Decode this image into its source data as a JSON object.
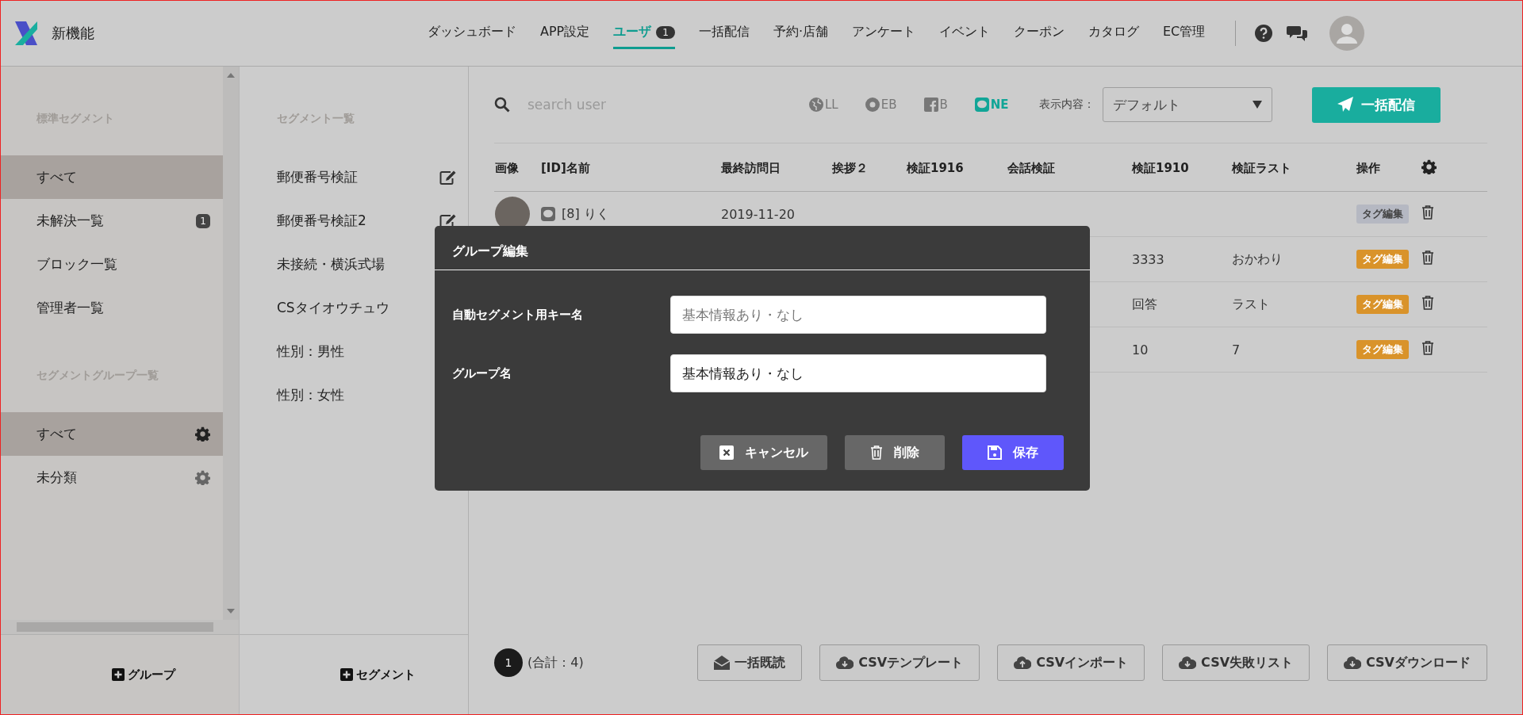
{
  "header": {
    "app_name": "新機能",
    "nav": [
      {
        "label": "ダッシュボード",
        "selected": false
      },
      {
        "label": "APP設定",
        "selected": false
      },
      {
        "label": "ユーザ",
        "selected": true,
        "badge": "1"
      },
      {
        "label": "一括配信",
        "selected": false
      },
      {
        "label": "予約·店舗",
        "selected": false
      },
      {
        "label": "アンケート",
        "selected": false
      },
      {
        "label": "イベント",
        "selected": false
      },
      {
        "label": "クーポン",
        "selected": false
      },
      {
        "label": "カタログ",
        "selected": false
      },
      {
        "label": "EC管理",
        "selected": false
      }
    ]
  },
  "sidebar": {
    "sections": [
      {
        "heading": "標準セグメント",
        "items": [
          {
            "label": "すべて",
            "selected": true
          },
          {
            "label": "未解決一覧",
            "selected": false,
            "badge": "1"
          },
          {
            "label": "ブロック一覧",
            "selected": false
          },
          {
            "label": "管理者一覧",
            "selected": false
          }
        ]
      },
      {
        "heading": "セグメントグループ一覧",
        "items": [
          {
            "label": "すべて",
            "selected": true,
            "settings": true
          },
          {
            "label": "未分類",
            "selected": false,
            "settings": true
          }
        ]
      }
    ],
    "add_button": "グループ"
  },
  "segments": {
    "heading": "セグメント一覧",
    "items": [
      "郵便番号検証",
      "郵便番号検証2",
      "未接続・横浜式場",
      "CSタイオウチュウ",
      "性別：男性",
      "性別：女性"
    ],
    "add_button": "セグメント"
  },
  "toolbar": {
    "search": {
      "placeholder": "search user"
    },
    "filters": [
      {
        "kind": "all",
        "label": "LL",
        "selected": false
      },
      {
        "kind": "web",
        "label": "EB",
        "selected": false
      },
      {
        "kind": "fb",
        "label": "B",
        "selected": false
      },
      {
        "kind": "line",
        "label": "NE",
        "selected": true
      }
    ],
    "display_label": "表示内容：",
    "display_value": "デフォルト",
    "send_button": "一括配信"
  },
  "table": {
    "columns": [
      "画像",
      "[ID]名前",
      "最終訪問日",
      "挨拶２",
      "検証1916",
      "会話検証",
      "検証1910",
      "検証ラスト",
      "操作"
    ],
    "rows": [
      {
        "cells": [
          "",
          "[8] りく",
          "2019-11-20"
        ],
        "tag_button": "タグ編集",
        "tag_disabled": true
      },
      {
        "cells": [
          "",
          "",
          "",
          "",
          "",
          "",
          "3333",
          "おかわり"
        ],
        "tag_button": "タグ編集",
        "tag_disabled": false
      },
      {
        "cells": [
          "",
          "",
          "",
          "",
          "",
          "",
          "回答",
          "ラスト"
        ],
        "tag_button": "タグ編集",
        "tag_disabled": false
      },
      {
        "cells": [
          "",
          "",
          "",
          "",
          "",
          "",
          "10",
          "7"
        ],
        "tag_button": "タグ編集",
        "tag_disabled": false
      }
    ]
  },
  "footer": {
    "page": "1",
    "total": "(合計：4)",
    "buttons": [
      {
        "kind": "read",
        "label": "一括既読"
      },
      {
        "kind": "download",
        "label": "CSVテンプレート"
      },
      {
        "kind": "upload",
        "label": "CSVインポート"
      },
      {
        "kind": "download",
        "label": "CSV失敗リスト"
      },
      {
        "kind": "download",
        "label": "CSVダウンロード"
      }
    ]
  },
  "modal": {
    "title": "グループ編集",
    "fields": [
      {
        "label": "自動セグメント用キー名",
        "placeholder": "基本情報あり・なし"
      },
      {
        "label": "グループ名",
        "value": "基本情報あり・なし"
      }
    ],
    "buttons": [
      {
        "kind": "cancel",
        "label": "キャンセル"
      },
      {
        "kind": "delete",
        "label": "削除"
      },
      {
        "kind": "save",
        "label": "保存"
      }
    ]
  }
}
